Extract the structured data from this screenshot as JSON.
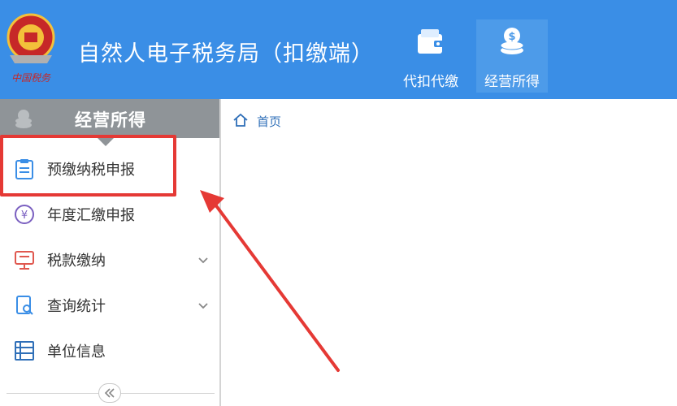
{
  "header": {
    "logo_text": "中国税务",
    "title": "自然人电子税务局（扣缴端）",
    "nav": [
      {
        "label": "代扣代缴",
        "icon": "wallet-icon"
      },
      {
        "label": "经营所得",
        "icon": "coins-icon"
      }
    ]
  },
  "sidebar": {
    "title": "经营所得",
    "items": [
      {
        "label": "预缴纳税申报",
        "icon": "clipboard-icon"
      },
      {
        "label": "年度汇缴申报",
        "icon": "yen-circle-icon"
      },
      {
        "label": "税款缴纳",
        "icon": "monitor-icon"
      },
      {
        "label": "查询统计",
        "icon": "search-document-icon"
      },
      {
        "label": "单位信息",
        "icon": "list-icon"
      }
    ],
    "collapse_icon": "double-chevron-left-icon"
  },
  "breadcrumb": {
    "home_label": "首页"
  },
  "colors": {
    "header_bg": "#3a8ee6",
    "sidebar_head_bg": "#8f9498",
    "highlight": "#e53935",
    "link": "#2f6fb8"
  }
}
